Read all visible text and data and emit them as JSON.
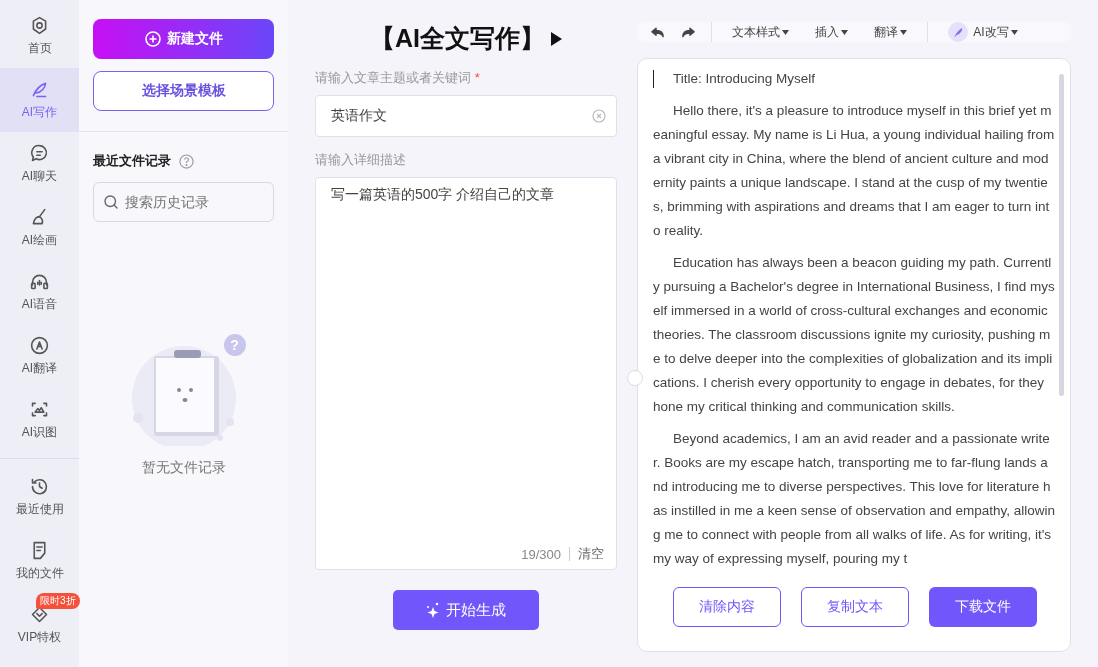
{
  "nav": {
    "items": [
      {
        "label": "首页",
        "selected": false
      },
      {
        "label": "AI写作",
        "selected": true
      },
      {
        "label": "AI聊天",
        "selected": false
      },
      {
        "label": "AI绘画",
        "selected": false
      },
      {
        "label": "AI语音",
        "selected": false
      },
      {
        "label": "AI翻译",
        "selected": false
      },
      {
        "label": "AI识图",
        "selected": false
      }
    ],
    "bottom_items": [
      {
        "label": "最近使用"
      },
      {
        "label": "我的文件"
      },
      {
        "label": "VIP特权",
        "badge": "限时3折"
      }
    ]
  },
  "files_panel": {
    "new_button": "新建文件",
    "template_button": "选择场景模板",
    "recent_title": "最近文件记录",
    "search": {
      "placeholder": "搜索历史记录"
    },
    "empty_mark": "?",
    "empty_text": "暂无文件记录"
  },
  "form": {
    "title": "【AI全文写作】",
    "topic_label": "请输入文章主题或者关键词",
    "required_mark": "*",
    "topic_value": "英语作文",
    "desc_label": "请输入详细描述",
    "desc_value": "写一篇英语的500字 介绍自己的文章",
    "counter": "19/300",
    "clear": "清空",
    "generate_button": "开始生成"
  },
  "toolbar": {
    "menus": [
      "文本样式",
      "插入",
      "翻译"
    ],
    "ai_menu": "AI改写"
  },
  "document": {
    "paragraphs": [
      "Title: Introducing Myself",
      "Hello there, it's a pleasure to introduce myself in this brief yet meaningful essay. My name is Li Hua, a young individual hailing from a vibrant city in China, where the blend of ancient culture and modernity paints a unique landscape. I stand at the cusp of my twenties, brimming with aspirations and dreams that I am eager to turn into reality.",
      "Education has always been a beacon guiding my path. Currently pursuing a Bachelor's degree in International Business, I find myself immersed in a world of cross-cultural exchanges and economic theories. The classroom discussions ignite my curiosity, pushing me to delve deeper into the complexities of globalization and its implications. I cherish every opportunity to engage in debates, for they hone my critical thinking and communication skills.",
      "Beyond academics, I am an avid reader and a passionate writer. Books are my escape hatch, transporting me to far-flung lands and introducing me to diverse perspectives. This love for literature has instilled in me a keen sense of observation and empathy, allowing me to connect with people from all walks of life. As for writing, it's my way of expressing myself, pouring my t"
    ],
    "buttons": [
      {
        "label": "清除内容",
        "kind": "outline"
      },
      {
        "label": "复制文本",
        "kind": "outline"
      },
      {
        "label": "下载文件",
        "kind": "primary"
      }
    ]
  }
}
